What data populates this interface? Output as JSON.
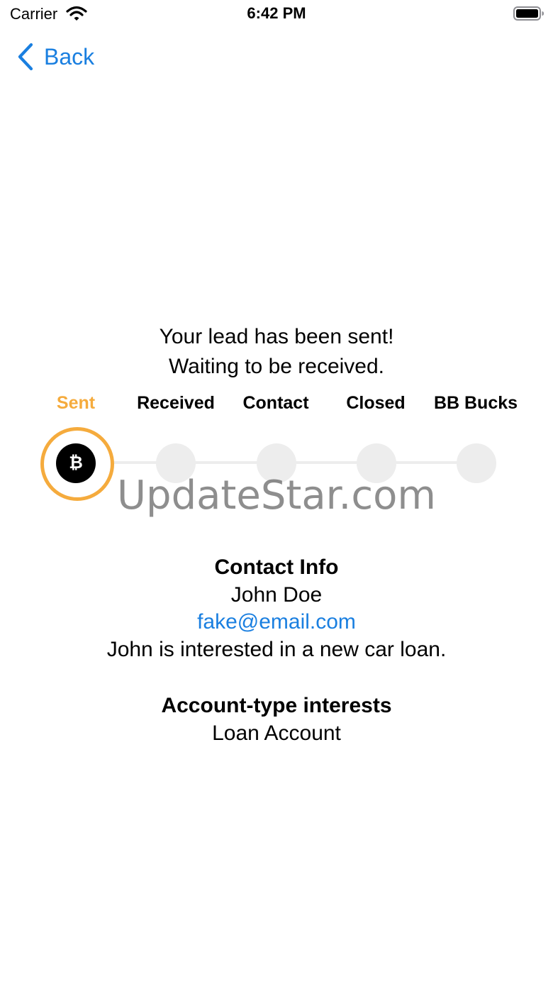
{
  "status_bar": {
    "carrier": "Carrier",
    "time": "6:42 PM",
    "wifi_icon": "wifi-icon",
    "battery_icon": "battery-icon"
  },
  "nav": {
    "back_label": "Back",
    "back_icon": "chevron-left-icon",
    "accent_color": "#1a7fe0"
  },
  "status": {
    "line1": "Your lead has been sent!",
    "line2": "Waiting to be received."
  },
  "stepper": {
    "active_index": 0,
    "active_color": "#f5ab3d",
    "steps": [
      {
        "label": "Sent"
      },
      {
        "label": "Received"
      },
      {
        "label": "Contact"
      },
      {
        "label": "Closed"
      },
      {
        "label": "BB Bucks"
      }
    ],
    "active_icon": "bitcoin-coin-icon",
    "active_icon_glyph": "₿"
  },
  "watermark": "UpdateStar.com",
  "contact": {
    "title": "Contact Info",
    "name": "John Doe",
    "email": "fake@email.com",
    "note": "John is interested in a new car loan."
  },
  "account": {
    "title": "Account-type interests",
    "value": "Loan Account"
  }
}
